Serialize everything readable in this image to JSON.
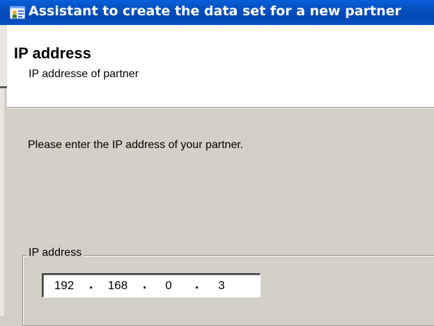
{
  "window": {
    "title": "Assistant to create the data set for a new partner",
    "icon": "wizard-app-icon"
  },
  "header": {
    "title": "IP address",
    "subtitle": "IP addresse of partner"
  },
  "main": {
    "prompt": "Please enter the IP address of your partner.",
    "group_label": "IP address",
    "ip": {
      "octet1": "192",
      "octet2": "168",
      "octet3": "0",
      "octet4": "3",
      "separator": "."
    }
  },
  "colors": {
    "titlebar": "#0552c6",
    "dialog_bg": "#d4d0c8",
    "header_bg": "#ffffff"
  }
}
